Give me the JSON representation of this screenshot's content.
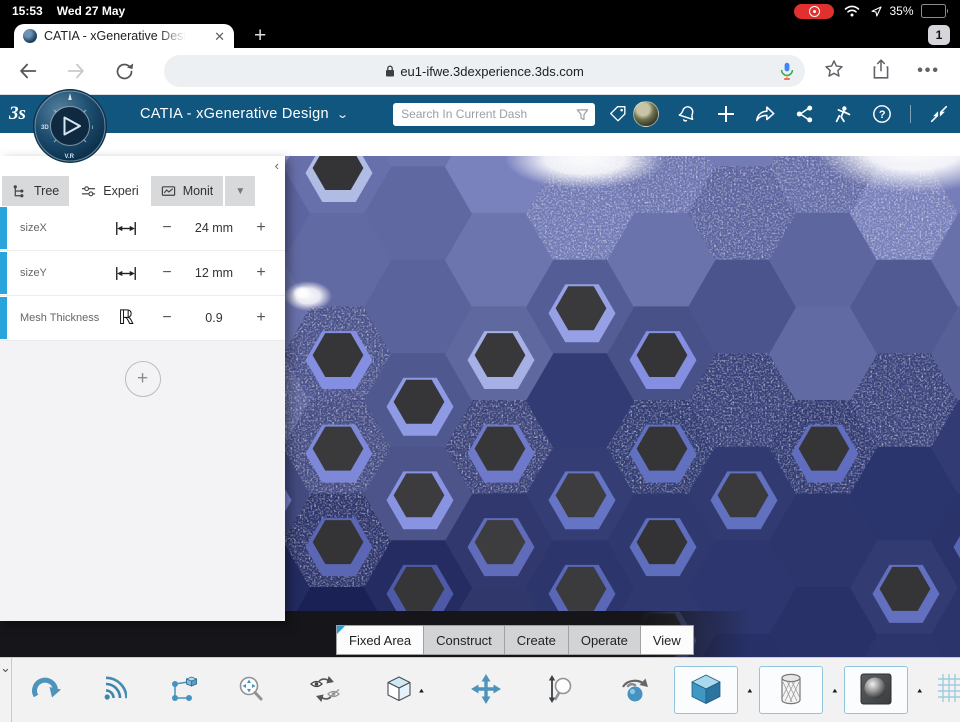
{
  "status_bar": {
    "time": "15:53",
    "date": "Wed 27 May",
    "battery_percent": "35%"
  },
  "browser": {
    "tab_title": "CATIA - xGenerative Desi",
    "close_glyph": "✕",
    "new_tab_glyph": "+",
    "tab_count": "1",
    "url": "eu1-ifwe.3dexperience.3ds.com",
    "menu_glyph": "•••"
  },
  "app_header": {
    "title": "CATIA - xGenerative Design",
    "title_chevron": "⌄",
    "search_placeholder": "Search In Current Dash",
    "right_icons": [
      "bell",
      "add",
      "share-arrow",
      "share-network",
      "swym",
      "help"
    ],
    "collapse_icon": "collapse"
  },
  "panel": {
    "collapse_glyph": "‹",
    "tabs": [
      {
        "label": "Tree",
        "icon": "tree-icon"
      },
      {
        "label": "Experi",
        "icon": "sliders-icon"
      },
      {
        "label": "Monit",
        "icon": "monitor-icon"
      }
    ],
    "tabs_dropdown_glyph": "▼",
    "params": [
      {
        "label": "sizeX",
        "icon": "length-icon",
        "minus": "−",
        "value": "24 mm",
        "plus": "+"
      },
      {
        "label": "sizeY",
        "icon": "length-icon",
        "minus": "−",
        "value": "12 mm",
        "plus": "+"
      },
      {
        "label": "Mesh Thickness",
        "icon": "real-number-icon",
        "minus": "−",
        "value": "0.9",
        "plus": "+"
      }
    ],
    "add_label": "+"
  },
  "mode_tabs": [
    {
      "label": "Fixed Area",
      "active": true
    },
    {
      "label": "Construct",
      "active": false
    },
    {
      "label": "Create",
      "active": false
    },
    {
      "label": "Operate",
      "active": false
    },
    {
      "label": "View",
      "active": true
    }
  ],
  "toolbar": {
    "collapse_glyph": "⌄",
    "caret_glyph": "▲",
    "group1": [
      "update",
      "stream",
      "graph-cube"
    ],
    "group2": [
      {
        "icon": "zoom-fit",
        "caret": false
      },
      {
        "icon": "swap-visibility",
        "caret": false
      },
      {
        "icon": "iso-cube",
        "caret": true
      },
      {
        "icon": "pan",
        "caret": false
      },
      {
        "icon": "zoom-direction",
        "caret": false
      },
      {
        "icon": "rotate-object",
        "caret": false
      }
    ],
    "view_modes": [
      {
        "icon": "shaded-cube",
        "caret": true
      },
      {
        "icon": "mesh-cylinder",
        "caret": true
      },
      {
        "icon": "material-sphere",
        "caret": true
      }
    ],
    "grid_icon": "grid"
  },
  "colors": {
    "header_blue": "#11567f",
    "accent_blue": "#2aa5dc",
    "toolbar_icon_blue": "#4e93bb",
    "hex_light": "#767eba",
    "hex_dark": "#262e62",
    "hole_gray": "#3a3a3c",
    "scene_bg": "#3b3b3e",
    "recording_red": "#e0312e"
  }
}
